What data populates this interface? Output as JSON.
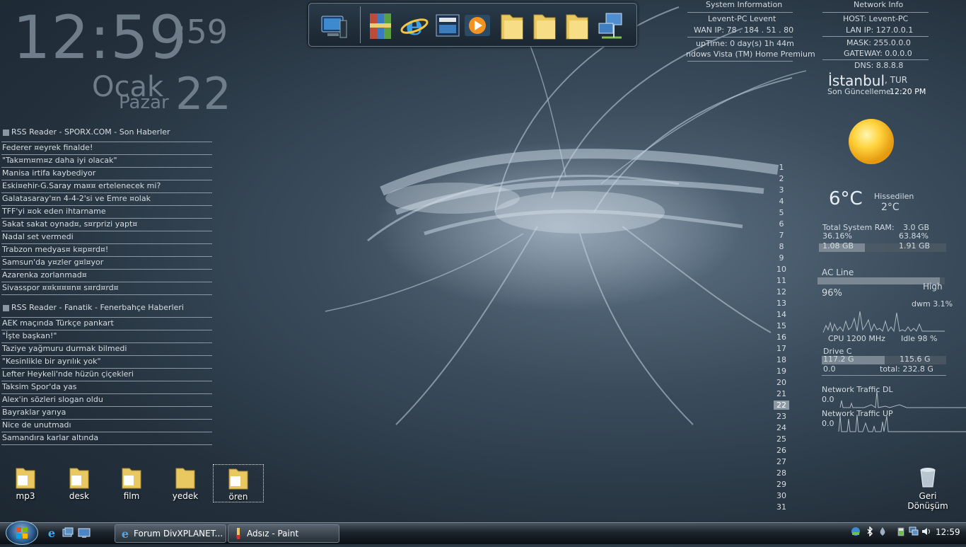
{
  "clock": {
    "time": "12:59",
    "seconds": ":59",
    "month": "Ocak",
    "weekday": "Pazar",
    "day": "22"
  },
  "rss1": {
    "title": "RSS Reader - SPORX.COM - Son Haberler",
    "items": [
      "Federer ¤eyrek finalde!",
      "\"Tak¤m¤m¤z daha iyi olacak\"",
      "Manisa irtifa kaybediyor",
      "Eski¤ehir-G.Saray ma¤¤ ertelenecek mi?",
      "Galatasaray'¤n 4-4-2'si ve Emre ¤olak",
      "TFF'yi ¤ok eden ihtarname",
      "Sakat sakat oynad¤, s¤rprizi yapt¤",
      "Nadal set vermedi",
      "Trabzon medyas¤ k¤p¤rd¤!",
      "Samsun'da y¤zler g¤l¤yor",
      "Azarenka zorlanmad¤",
      "Sivasspor ¤¤k¤¤¤n¤ s¤rd¤rd¤"
    ]
  },
  "rss2": {
    "title": "RSS Reader - Fanatik - Fenerbahçe Haberleri",
    "items": [
      "AEK maçında Türkçe pankart",
      "\"İşte başkan!\"",
      "Taziye yağmuru durmak bilmedi",
      "\"Kesinlikle bir ayrılık yok\"",
      "Lefter Heykeli'nde hüzün çiçekleri",
      "Taksim Spor'da yas",
      "Alex'in sözleri slogan oldu",
      "Bayraklar yarıya",
      "Nice de unutmadı",
      "Samandıra karlar altında"
    ]
  },
  "sysinfo": {
    "title": "System Information",
    "computer": "Levent-PC  Levent",
    "wan": "WAN IP: 78 . 184 . 51 . 80",
    "uptime": "upTime: 0 day(s) 1h 44m",
    "os": "ndows Vista (TM) Home Premium"
  },
  "netinfo": {
    "title": "Network Info",
    "host": "HOST: Levent-PC",
    "lan": "LAN IP: 127.0.0.1",
    "mask": "MASK: 255.0.0.0",
    "gateway": "GATEWAY: 0.0.0.0",
    "dns": "DNS: 8.8.8.8"
  },
  "weather": {
    "city": "İstanbul",
    "country": ", TUR",
    "updated_label": "Son Güncelleme",
    "updated_time": "12:20 PM",
    "temp": "6°C",
    "feels_label": "Hissedilen",
    "feels": "2°C"
  },
  "ram": {
    "label": "Total System RAM:",
    "total": "3.0 GB",
    "used_pct": "36.16%",
    "free_pct": "63.84%",
    "used": "1.08 GB",
    "free": "1.91 GB",
    "used_fraction": 0.3616
  },
  "power": {
    "label": "AC Line",
    "level": "High",
    "pct": "96%",
    "fraction": 0.96
  },
  "cpu": {
    "process": "dwm 3.1%",
    "freq": "CPU 1200 MHz",
    "idle": "Idle 98 %"
  },
  "drive": {
    "label": "Drive C",
    "used": "117.2 G",
    "free": "115.6 G",
    "zero": "0.0",
    "total": "total: 232.8 G",
    "used_fraction": 0.503
  },
  "net_dl": {
    "label": "Network Traffic DL",
    "value": "0.0"
  },
  "net_ul": {
    "label": "Network Traffic UP",
    "value": "0.0"
  },
  "calendar": {
    "days": [
      "1",
      "2",
      "3",
      "4",
      "5",
      "6",
      "7",
      "8",
      "9",
      "10",
      "11",
      "12",
      "13",
      "14",
      "15",
      "16",
      "17",
      "18",
      "19",
      "20",
      "21",
      "22",
      "23",
      "24",
      "25",
      "26",
      "27",
      "28",
      "29",
      "30",
      "31"
    ],
    "selected": "22"
  },
  "desktop_icons": [
    "mp3",
    "desk",
    "film",
    "yedek",
    "ören"
  ],
  "recycle_bin": {
    "line1": "Geri",
    "line2": "Dönüşüm"
  },
  "dock_icons": [
    "computer-icon",
    "winrar-icon",
    "internet-explorer-icon",
    "media-center-icon",
    "media-player-icon",
    "folder-icon",
    "folder-icon",
    "folder-icon",
    "network-icon"
  ],
  "taskbar": {
    "buttons": [
      "Forum DivXPLANET...",
      "Adsız - Paint"
    ],
    "time": "12:59"
  },
  "colors": {
    "accent": "#8d9aa5",
    "background": "#2c3b48"
  }
}
